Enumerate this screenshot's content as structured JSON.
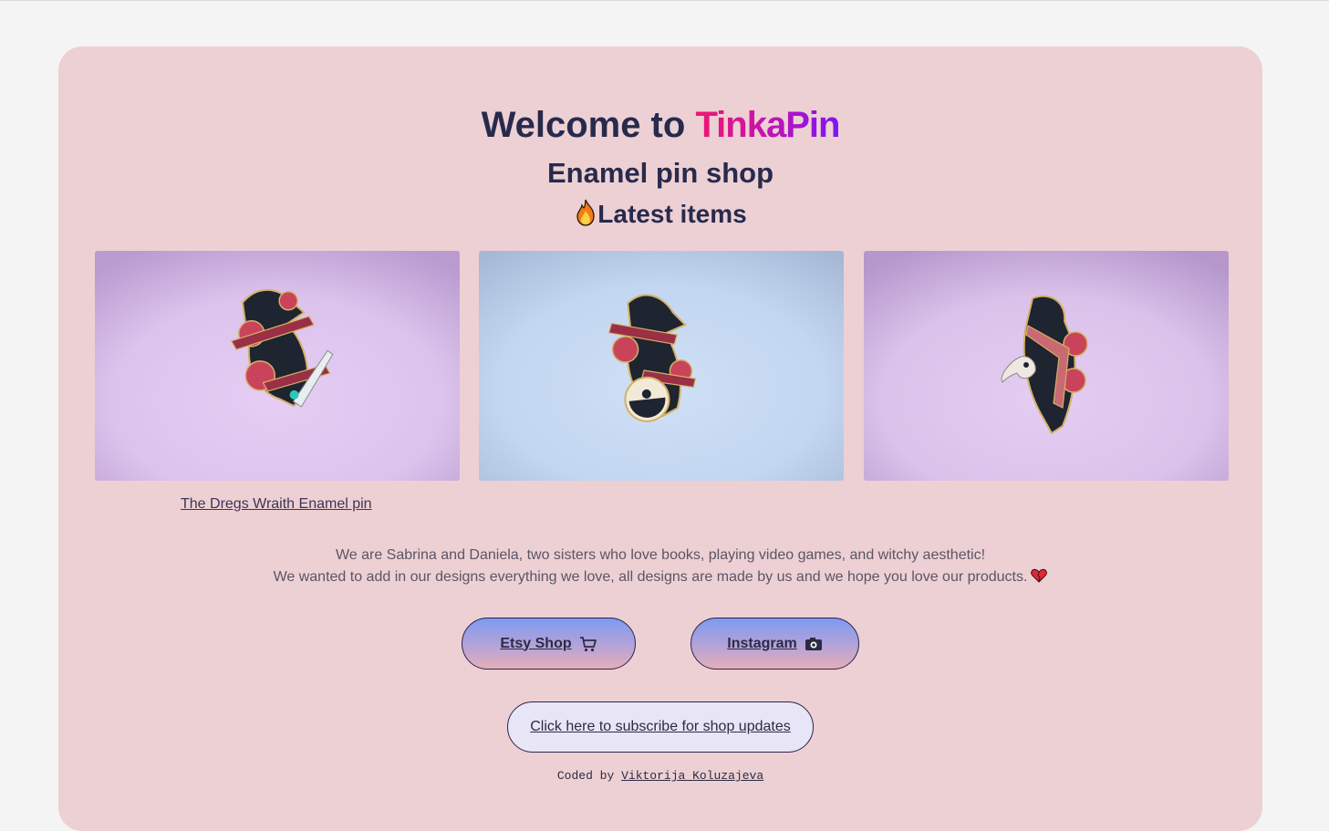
{
  "hero": {
    "title_prefix": "Welcome to",
    "brand": "TinkaPin",
    "subtitle": "Enamel pin shop",
    "latest_label": "Latest items"
  },
  "gallery": {
    "items": [
      {
        "alt": "Raven enamel pin with roses, dagger and 'NO MOURNERS' ribbon",
        "background": "#dcc3ec"
      },
      {
        "alt": "Raven enamel pin with skull potion bottle and roses",
        "background": "#c3d6f0"
      },
      {
        "alt": "Raven enamel pin with plague doctor mask and roses",
        "background": "#dac2ea"
      }
    ],
    "first_caption": "The Dregs Wraith Enamel pin"
  },
  "about": {
    "line1": "We are Sabrina and Daniela, two sisters who love books, playing video games, and witchy aesthetic!",
    "line2": "We wanted to add in our designs everything we love, all designs are made by us and we hope you love our products."
  },
  "buttons": {
    "etsy": "Etsy Shop",
    "instagram": "Instagram",
    "subscribe": "Click here to subscribe for shop updates"
  },
  "footer": {
    "prefix": "Coded by",
    "author": "Viktorija Koluzajeva"
  },
  "colors": {
    "page_bg": "#f4f4f4",
    "card_bg": "#edd0d3",
    "heading": "#272a4d",
    "brand_gradient": [
      "#f0186e",
      "#c413b2",
      "#7a17f5"
    ],
    "button_gradient": [
      "#7e9af0",
      "#b5a3d8",
      "#e6aeb8"
    ]
  },
  "icons": [
    "fire-icon",
    "heart-icon",
    "cart-icon",
    "camera-icon"
  ]
}
